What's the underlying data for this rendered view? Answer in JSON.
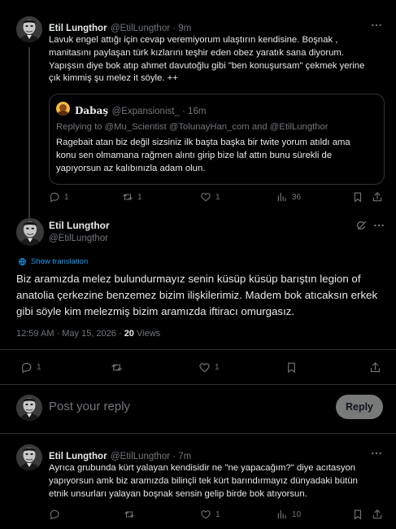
{
  "tweet1": {
    "author_name": "Etil Lungthor",
    "handle_time": "@EtilLungthor · 9m",
    "lines": [
      "Lavuk engel attığı için cevap veremiyorum ulaştırın kendisine. Boşnak ,",
      "manitasını paylaşan türk kızlarını teşhir eden obez yaratık sana diyorum.",
      "Yapışsın diye bok atıp ahmet davutoğlu gibi \"ben konuşursam\" çekmek yerine",
      "çık kimmiş şu melez it söyle. ++"
    ],
    "quote": {
      "author_name": "Dabaş",
      "handle_time": "@Expansionist_ · 16m",
      "replying_to": "Replying to @Mu_Scientist @TolunayHan_com and @EtilLungthor",
      "lines": [
        "Ragebait atan biz değil sizsiniz ilk başta başka bir twite yorum atıldı ama",
        "konu sen olmamana rağmen alıntı girip bize laf attın bunu sürekli de",
        "yapıyorsun az kalıbınızla adam olun."
      ]
    },
    "actions": {
      "replies": "1",
      "retweets": "1",
      "likes": "1",
      "views": "36"
    }
  },
  "main_tweet": {
    "author_name": "Etil Lungthor",
    "handle": "@EtilLungthor",
    "show_translation": "Show translation",
    "lines": [
      "Biz aramızda melez bulundurmayız senin küsüp küsüp barıştın legion of",
      "anatolia çerkezine benzemez bizim ilişkilerimiz. Madem bok atıcaksın erkek",
      "gibi söyle kim melezmiş bizim aramızda iftiracı omurgasız."
    ],
    "timestamp": "12:59 AM · May 15, 2026 · ",
    "views_count": "20",
    "views_label": " Views",
    "actions": {
      "replies": "1",
      "retweets": "",
      "likes": "1"
    }
  },
  "compose": {
    "placeholder": "Post your reply",
    "button_label": "Reply"
  },
  "tweet3": {
    "author_name": "Etil Lungthor",
    "handle_time": "@EtilLungthor · 7m",
    "lines": [
      "Ayrıca grubunda kürt yalayan kendisidir ne \"ne yapacağım?\" diye acıtasyon",
      "yapıyorsun amk biz aramızda bilinçli tek kürt barındırmayız dünyadaki bütün",
      "etnik unsurları yalayan boşnak sensin gelip birde bok atıyorsun."
    ],
    "actions": {
      "replies": "",
      "retweets": "",
      "likes": "1",
      "views": "10"
    }
  },
  "colors": {
    "background": "#000000",
    "text": "#e7e9ea",
    "muted": "#71767b",
    "link": "#1d9bf0",
    "border": "#2f3336"
  }
}
